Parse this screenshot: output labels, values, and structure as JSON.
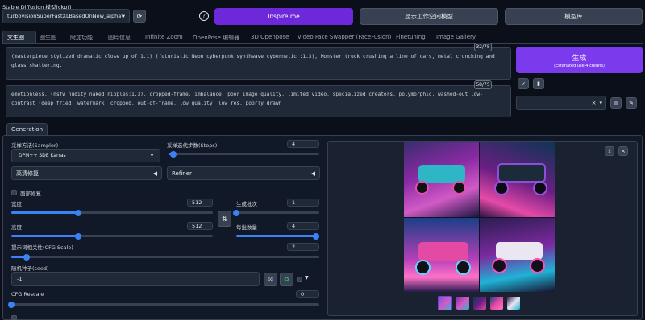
{
  "header": {
    "checkpoint_label": "Stable Diffusion 模型(ckpt)",
    "checkpoint_value": "turbovisionSuperFastXLBasedOnNew_alphaV",
    "inspire_label": "Inspire me",
    "workspace_label": "显示工作空间模型",
    "model_lib_label": "模型库",
    "accent": "#6d28d9"
  },
  "tabs": [
    "文生图",
    "图生图",
    "附加功能",
    "图片信息",
    "Infinite Zoom",
    "OpenPose 编辑器",
    "3D Openpose",
    "Video Face Swapper (FaceFusion)",
    "Finetuning",
    "Image Gallery"
  ],
  "prompt": {
    "text": "(masterpiece stylized dramatic close up of:1.1) (futuristic Neon cyberpunk synthwave cybernetic :1.3), Monster truck crushing a line of cars, metal crunching and glass shattering.",
    "counter": "32/75"
  },
  "negative": {
    "text": "emotionless, (nsfw nudity naked nipples:1.3), cropped-frame, imbalance, poor image quality, limited video, specialized creators, polymorphic, washed-out low-contrast (deep fried) watermark, cropped, out-of-frame, low quality, low res, poorly drawn",
    "counter": "58/75"
  },
  "generate": {
    "label": "生成",
    "sub": "(Estimated use 4 credits)"
  },
  "subtab": "Generation",
  "sampler": {
    "label": "采样方法(Sampler)",
    "value": "DPM++ SDE Karras"
  },
  "steps": {
    "label": "采样迭代步数(Steps)",
    "value": "4",
    "fraction": 0.03
  },
  "hires": "高清修复",
  "refiner": "Refiner",
  "face_restore": "面部修复",
  "width": {
    "label": "宽度",
    "value": "512",
    "fraction": 0.33
  },
  "height": {
    "label": "高度",
    "value": "512",
    "fraction": 0.33
  },
  "batch_count": {
    "label": "生成批次",
    "value": "1",
    "fraction": 0.0
  },
  "batch_size": {
    "label": "每批数量",
    "value": "4",
    "fraction": 1.0
  },
  "cfg": {
    "label": "提示词相关性(CFG Scale)",
    "value": "2",
    "fraction": 0.05
  },
  "seed": {
    "label": "随机种子(seed)",
    "value": "-1"
  },
  "cfg_rescale": {
    "label": "CFG Rescale",
    "value": "0",
    "fraction": 0.0
  }
}
